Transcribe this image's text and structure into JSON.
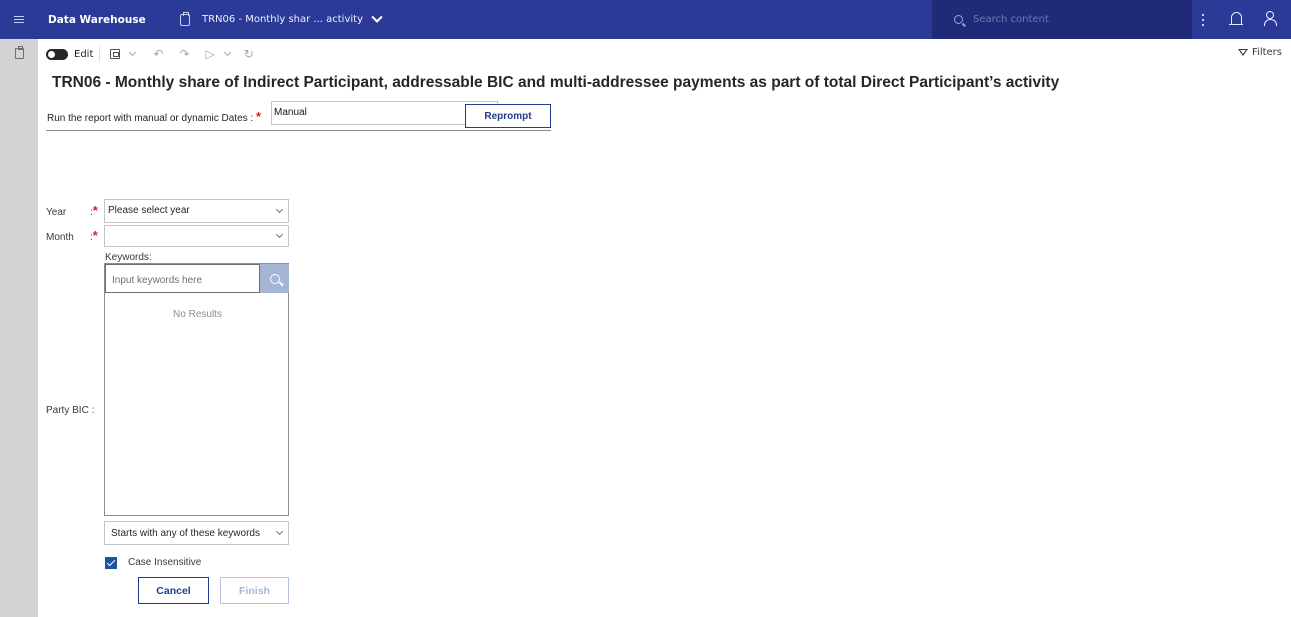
{
  "header": {
    "app_title": "Data Warehouse",
    "tab_label": "TRN06 - Monthly shar ... activity",
    "search_placeholder": "Search content"
  },
  "toolbar": {
    "edit_label": "Edit",
    "filters_label": "Filters"
  },
  "report": {
    "title": "TRN06 - Monthly share of Indirect Participant, addressable BIC and multi-addressee payments as part of total Direct Participant’s activity"
  },
  "prompt": {
    "dates_label": "Run the report with manual or dynamic Dates :",
    "required_mark": "*",
    "dates_value": "Manual",
    "reprompt_label": "Reprompt"
  },
  "form": {
    "year_label": "Year",
    "year_colon": ":",
    "year_value": "Please select year",
    "month_label": "Month",
    "month_colon": ":",
    "month_value": "",
    "party_bic_label": "Party BIC :",
    "keywords_label": "Keywords:",
    "keywords_placeholder": "Input keywords here",
    "no_results": "No Results",
    "match_mode": "Starts with any of these keywords",
    "case_insensitive_label": "Case Insensitive",
    "case_insensitive_checked": true,
    "cancel_label": "Cancel",
    "finish_label": "Finish"
  }
}
